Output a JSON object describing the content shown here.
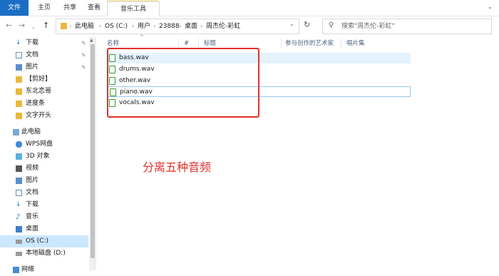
{
  "ribbon": {
    "tabs": [
      "文件",
      "主页",
      "共享",
      "查看"
    ],
    "context_tab": "音乐工具"
  },
  "address": {
    "crumbs": [
      "此电脑",
      "OS (C:)",
      "用户",
      "23888",
      "桌面",
      "周杰伦-彩虹"
    ]
  },
  "search": {
    "placeholder": "搜索\"周杰伦-彩虹\""
  },
  "columns": [
    "名称",
    "#",
    "标题",
    "参与创作的艺术家",
    "唱片集"
  ],
  "files": [
    {
      "name": "bass.wav"
    },
    {
      "name": "drums.wav"
    },
    {
      "name": "other.wav"
    },
    {
      "name": "piano.wav"
    },
    {
      "name": "vocals.wav"
    }
  ],
  "nav": [
    {
      "label": "下载",
      "icon": "download-arrow-icon",
      "pinned": true
    },
    {
      "label": "文档",
      "icon": "document-icon",
      "pinned": true
    },
    {
      "label": "图片",
      "icon": "picture-icon",
      "pinned": true
    },
    {
      "label": "【剪好】",
      "icon": "folder-icon",
      "pinned": false
    },
    {
      "label": "东北恋哥",
      "icon": "folder-icon",
      "pinned": false
    },
    {
      "label": "进度条",
      "icon": "folder-icon",
      "pinned": false
    },
    {
      "label": "文字开头",
      "icon": "folder-icon",
      "pinned": false
    },
    {
      "label": "此电脑",
      "icon": "computer-icon",
      "pinned": false
    },
    {
      "label": "WPS网盘",
      "icon": "cloud-icon",
      "pinned": false
    },
    {
      "label": "3D 对象",
      "icon": "cube-icon",
      "pinned": false
    },
    {
      "label": "视频",
      "icon": "video-icon",
      "pinned": false
    },
    {
      "label": "图片",
      "icon": "picture-icon",
      "pinned": false
    },
    {
      "label": "文档",
      "icon": "document-icon",
      "pinned": false
    },
    {
      "label": "下载",
      "icon": "download-arrow-icon",
      "pinned": false
    },
    {
      "label": "音乐",
      "icon": "music-note-icon",
      "pinned": false
    },
    {
      "label": "桌面",
      "icon": "desktop-icon",
      "pinned": false
    },
    {
      "label": "OS (C:)",
      "icon": "drive-icon",
      "pinned": false
    },
    {
      "label": "本地磁盘 (D:)",
      "icon": "drive-icon",
      "pinned": false
    },
    {
      "label": "网络",
      "icon": "network-icon",
      "pinned": false
    }
  ],
  "annotation": "分离五种音频",
  "colors": {
    "accent": "#1a6fc4",
    "annotation": "#e0322b",
    "selection": "#cce8ff",
    "folder": "#e8b93b"
  }
}
